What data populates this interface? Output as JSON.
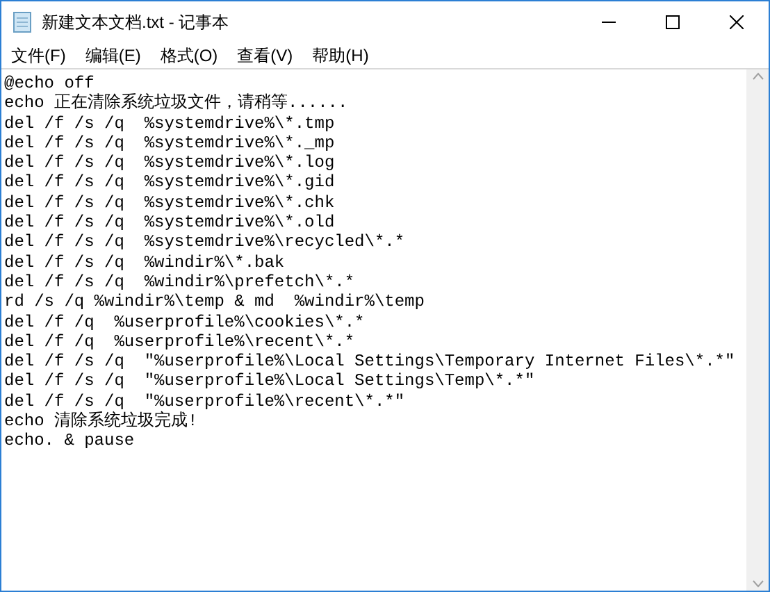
{
  "window": {
    "title": "新建文本文档.txt - 记事本"
  },
  "menu": [
    "文件(F)",
    "编辑(E)",
    "格式(O)",
    "查看(V)",
    "帮助(H)"
  ],
  "editor": {
    "lines": [
      "@echo off",
      "echo 正在清除系统垃圾文件，请稍等......",
      "del /f /s /q  %systemdrive%\\*.tmp",
      "del /f /s /q  %systemdrive%\\*._mp",
      "del /f /s /q  %systemdrive%\\*.log",
      "del /f /s /q  %systemdrive%\\*.gid",
      "del /f /s /q  %systemdrive%\\*.chk",
      "del /f /s /q  %systemdrive%\\*.old",
      "del /f /s /q  %systemdrive%\\recycled\\*.*",
      "del /f /s /q  %windir%\\*.bak",
      "del /f /s /q  %windir%\\prefetch\\*.*",
      "rd /s /q %windir%\\temp & md  %windir%\\temp",
      "del /f /q  %userprofile%\\cookies\\*.*",
      "del /f /q  %userprofile%\\recent\\*.*",
      "del /f /s /q  ″%userprofile%\\Local Settings\\Temporary Internet Files\\*.*″",
      "del /f /s /q  ″%userprofile%\\Local Settings\\Temp\\*.*″",
      "del /f /s /q  ″%userprofile%\\recent\\*.*″",
      "echo 清除系统垃圾完成!",
      "echo. & pause"
    ]
  }
}
